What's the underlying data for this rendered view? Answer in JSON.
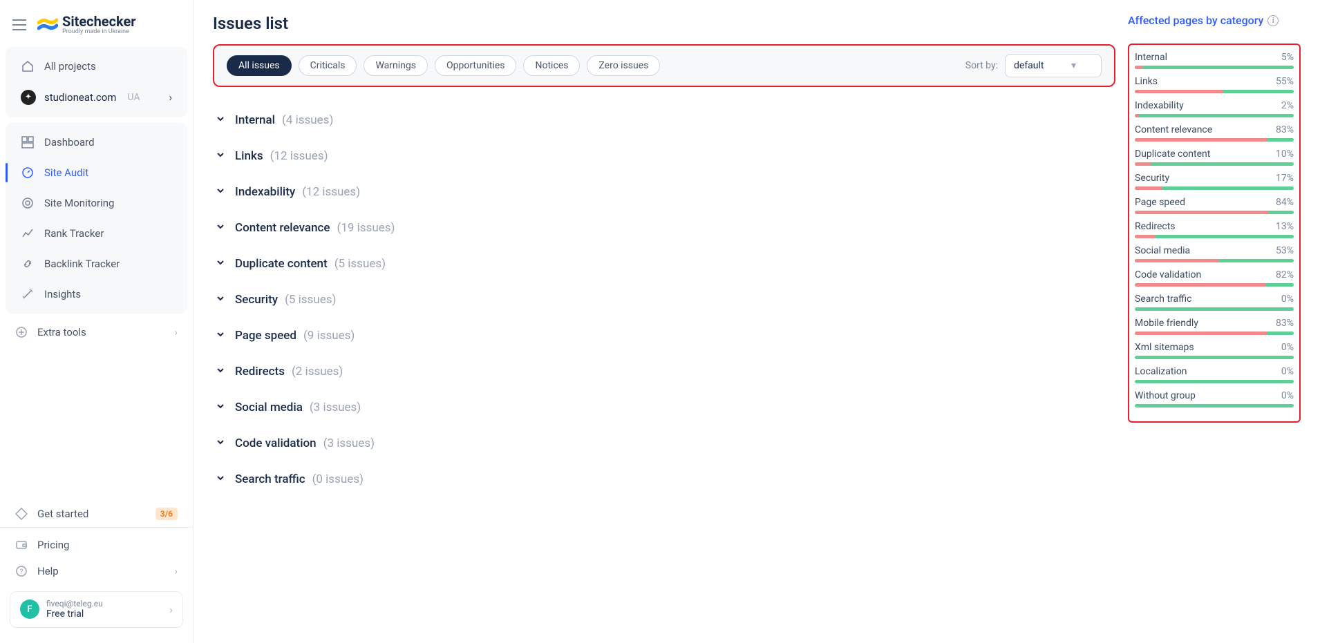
{
  "brand": {
    "name": "Sitechecker",
    "tagline": "Proudly made in Ukraine"
  },
  "sidebar": {
    "all_projects": "All projects",
    "project": {
      "domain": "studioneat.com",
      "locale": "UA"
    },
    "nav": {
      "dashboard": "Dashboard",
      "site_audit": "Site Audit",
      "site_monitoring": "Site Monitoring",
      "rank_tracker": "Rank Tracker",
      "backlink_tracker": "Backlink Tracker",
      "insights": "Insights"
    },
    "extra_tools": "Extra tools",
    "get_started": {
      "label": "Get started",
      "progress": "3/6"
    },
    "pricing": "Pricing",
    "help": "Help",
    "user": {
      "initial": "F",
      "email": "fiveqi@teleg.eu",
      "plan": "Free trial"
    }
  },
  "page": {
    "title": "Issues list",
    "filters": {
      "all": "All issues",
      "criticals": "Criticals",
      "warnings": "Warnings",
      "opportunities": "Opportunities",
      "notices": "Notices",
      "zero": "Zero issues"
    },
    "sort": {
      "label": "Sort by:",
      "value": "default"
    },
    "issues": [
      {
        "name": "Internal",
        "count_text": "(4 issues)"
      },
      {
        "name": "Links",
        "count_text": "(12 issues)"
      },
      {
        "name": "Indexability",
        "count_text": "(12 issues)"
      },
      {
        "name": "Content relevance",
        "count_text": "(19 issues)"
      },
      {
        "name": "Duplicate content",
        "count_text": "(5 issues)"
      },
      {
        "name": "Security",
        "count_text": "(5 issues)"
      },
      {
        "name": "Page speed",
        "count_text": "(9 issues)"
      },
      {
        "name": "Redirects",
        "count_text": "(2 issues)"
      },
      {
        "name": "Social media",
        "count_text": "(3 issues)"
      },
      {
        "name": "Code validation",
        "count_text": "(3 issues)"
      },
      {
        "name": "Search traffic",
        "count_text": "(0 issues)"
      }
    ],
    "affected_title": "Affected pages by category",
    "categories": [
      {
        "name": "Internal",
        "pct": 5,
        "pct_text": "5%"
      },
      {
        "name": "Links",
        "pct": 55,
        "pct_text": "55%"
      },
      {
        "name": "Indexability",
        "pct": 2,
        "pct_text": "2%"
      },
      {
        "name": "Content relevance",
        "pct": 83,
        "pct_text": "83%"
      },
      {
        "name": "Duplicate content",
        "pct": 10,
        "pct_text": "10%"
      },
      {
        "name": "Security",
        "pct": 17,
        "pct_text": "17%"
      },
      {
        "name": "Page speed",
        "pct": 84,
        "pct_text": "84%"
      },
      {
        "name": "Redirects",
        "pct": 13,
        "pct_text": "13%"
      },
      {
        "name": "Social media",
        "pct": 53,
        "pct_text": "53%"
      },
      {
        "name": "Code validation",
        "pct": 82,
        "pct_text": "82%"
      },
      {
        "name": "Search traffic",
        "pct": 0,
        "pct_text": "0%"
      },
      {
        "name": "Mobile friendly",
        "pct": 83,
        "pct_text": "83%"
      },
      {
        "name": "Xml sitemaps",
        "pct": 0,
        "pct_text": "0%"
      },
      {
        "name": "Localization",
        "pct": 0,
        "pct_text": "0%"
      },
      {
        "name": "Without group",
        "pct": 0,
        "pct_text": "0%"
      }
    ]
  }
}
